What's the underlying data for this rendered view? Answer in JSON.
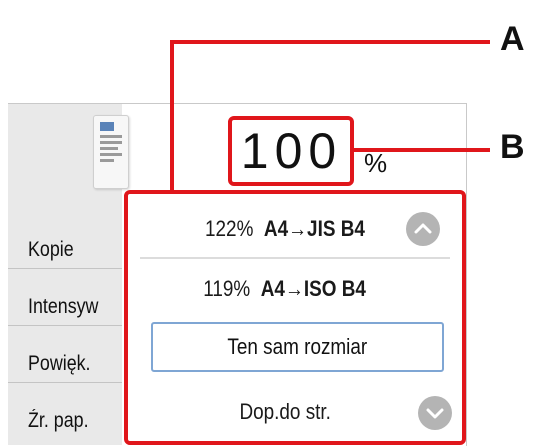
{
  "callouts": {
    "a": "A",
    "b": "B"
  },
  "zoom": {
    "value": "100",
    "unit": "%"
  },
  "menu": [
    {
      "label": "Kopie"
    },
    {
      "label": "Intensyw"
    },
    {
      "label": "Powięk."
    },
    {
      "label": "Źr. pap."
    }
  ],
  "options": [
    {
      "percent": "122%",
      "size": "A4→JIS B4"
    },
    {
      "percent": "119%",
      "size": "A4→ISO B4"
    }
  ],
  "selected_option": "Ten sam rozmiar",
  "fit_option": "Dop.do str.",
  "icons": [
    "scroll-up-icon",
    "scroll-down-icon",
    "document-preview-icon"
  ],
  "colors": {
    "highlight": "#e0161b",
    "selected_border": "#7fa6d4",
    "scroll_button": "#b4b4b4"
  }
}
